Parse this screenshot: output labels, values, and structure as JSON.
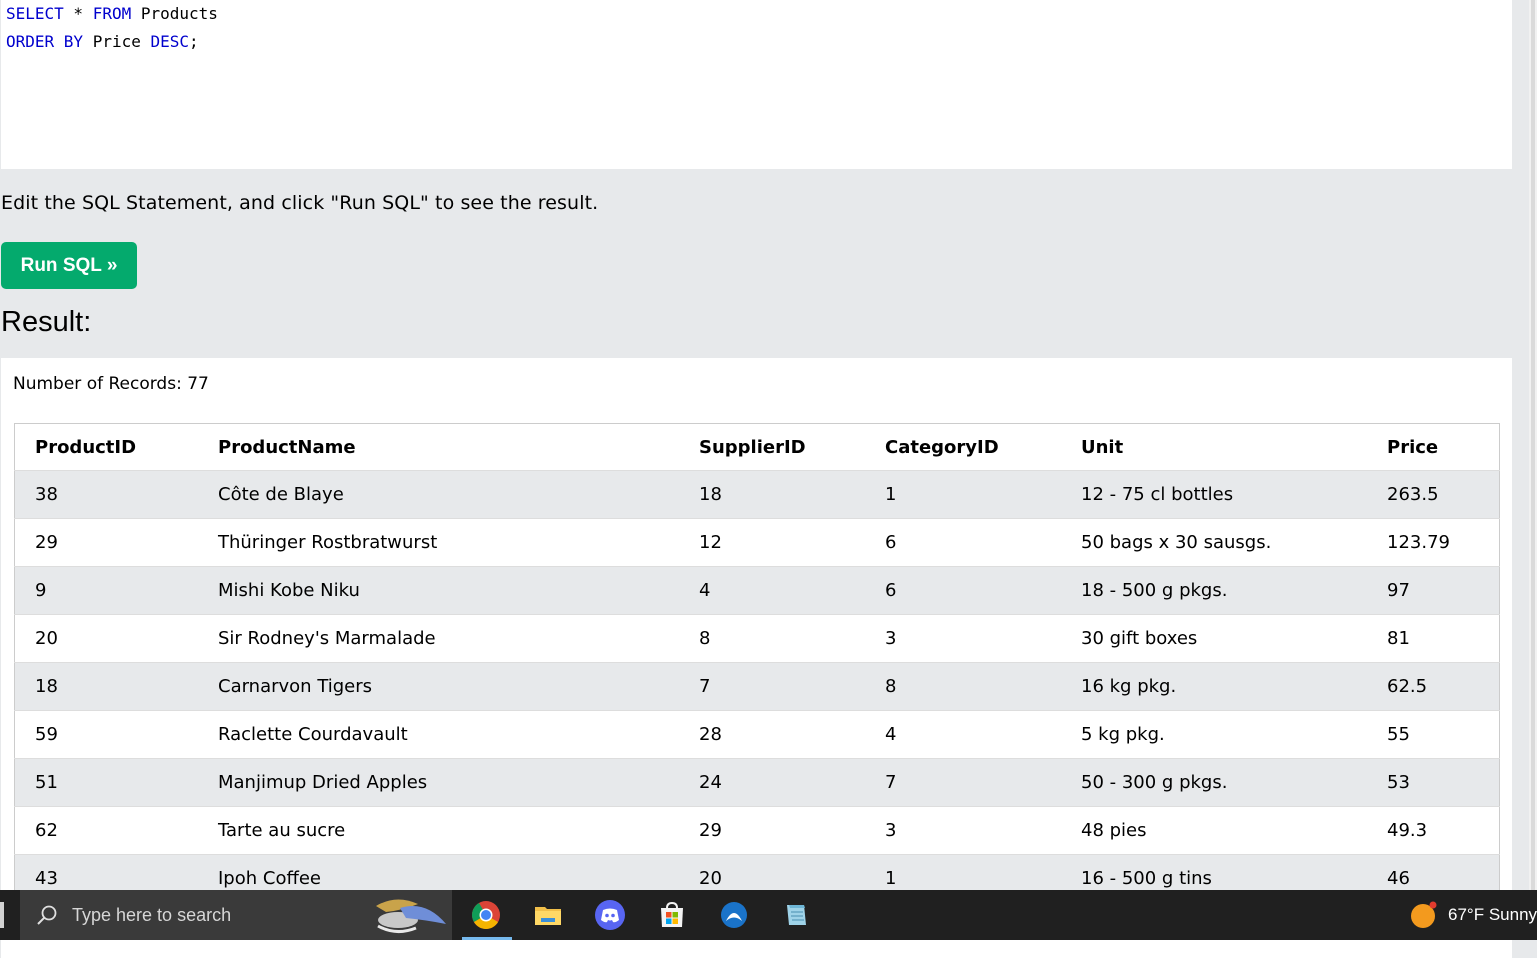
{
  "editor": {
    "line1": {
      "kw1": "SELECT",
      "rest1": " * ",
      "kw2": "FROM",
      "rest2": " Products"
    },
    "line2": {
      "kw1": "ORDER BY",
      "rest1": " Price ",
      "kw2": "DESC",
      "rest2": ";"
    }
  },
  "instruction": "Edit the SQL Statement, and click \"Run SQL\" to see the result.",
  "run_button": "Run SQL »",
  "result_heading": "Result:",
  "record_count": "Number of Records: 77",
  "table": {
    "headers": [
      "ProductID",
      "ProductName",
      "SupplierID",
      "CategoryID",
      "Unit",
      "Price"
    ],
    "rows": [
      [
        "38",
        "Côte de Blaye",
        "18",
        "1",
        "12 - 75 cl bottles",
        "263.5"
      ],
      [
        "29",
        "Thüringer Rostbratwurst",
        "12",
        "6",
        "50 bags x 30 sausgs.",
        "123.79"
      ],
      [
        "9",
        "Mishi Kobe Niku",
        "4",
        "6",
        "18 - 500 g pkgs.",
        "97"
      ],
      [
        "20",
        "Sir Rodney's Marmalade",
        "8",
        "3",
        "30 gift boxes",
        "81"
      ],
      [
        "18",
        "Carnarvon Tigers",
        "7",
        "8",
        "16 kg pkg.",
        "62.5"
      ],
      [
        "59",
        "Raclette Courdavault",
        "28",
        "4",
        "5 kg pkg.",
        "55"
      ],
      [
        "51",
        "Manjimup Dried Apples",
        "24",
        "7",
        "50 - 300 g pkgs.",
        "53"
      ],
      [
        "62",
        "Tarte au sucre",
        "29",
        "3",
        "48 pies",
        "49.3"
      ],
      [
        "43",
        "Ipoh Coffee",
        "20",
        "1",
        "16 - 500 g tins",
        "46"
      ]
    ]
  },
  "taskbar": {
    "search_placeholder": "Type here to search",
    "apps": [
      "chrome-icon",
      "file-explorer-icon",
      "discord-icon",
      "microsoft-store-icon",
      "app-circle-icon",
      "notepad-icon"
    ],
    "weather": "67°F  Sunny"
  },
  "colors": {
    "keyword": "#0000cd",
    "run_button": "#04aa6d",
    "page_bg": "#e7e9eb"
  }
}
